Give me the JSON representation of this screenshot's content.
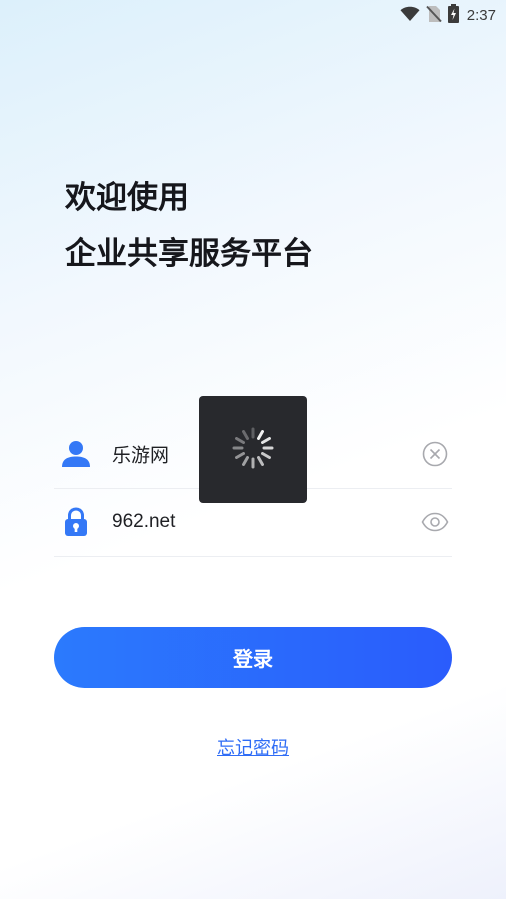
{
  "status_bar": {
    "time": "2:37",
    "icons": [
      "wifi-icon",
      "no-sim-icon",
      "battery-charging-icon"
    ]
  },
  "welcome": {
    "line1": "欢迎使用",
    "line2": "企业共享服务平台"
  },
  "username_field": {
    "value": "乐游网",
    "icon": "user-icon",
    "action_icon": "clear-icon"
  },
  "password_field": {
    "value": "962.net",
    "icon": "lock-icon",
    "action_icon": "eye-icon"
  },
  "login_button": {
    "label": "登录"
  },
  "forgot_password": {
    "label": "忘记密码"
  },
  "loading_overlay": {
    "icon": "spinner-icon"
  },
  "colors": {
    "accent": "#2b6dfc",
    "link": "#2e6cf6",
    "icon_blue": "#3478f6",
    "loading_bg": "#28292d"
  }
}
